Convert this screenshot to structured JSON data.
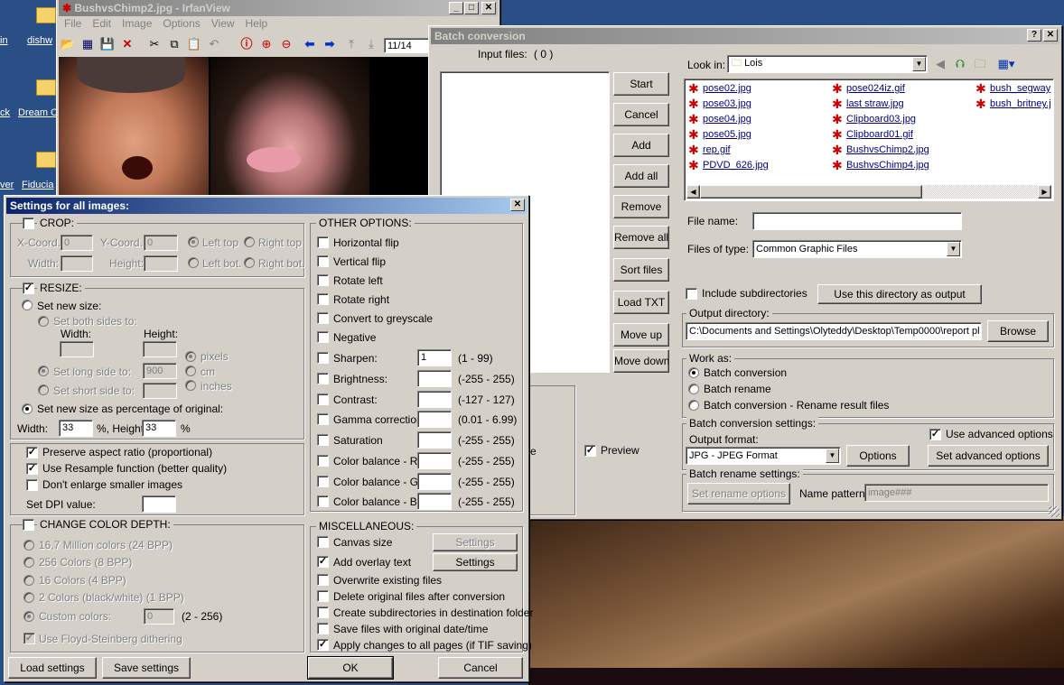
{
  "desktop": {
    "labels": [
      "in",
      "dishw",
      "ck",
      "Dream C",
      "ver",
      "Fiducia"
    ]
  },
  "irfan": {
    "title": "BushvsChimp2.jpg - IrfanView",
    "menu": [
      "File",
      "Edit",
      "Image",
      "Options",
      "View",
      "Help"
    ],
    "page_counter": "11/14"
  },
  "batch": {
    "title": "Batch conversion",
    "input_files_label": "Input files:",
    "input_files_count": "( 0 )",
    "buttons": {
      "start": "Start",
      "cancel": "Cancel",
      "add": "Add",
      "add_all": "Add all",
      "remove": "Remove",
      "remove_all": "Remove all",
      "sort_files": "Sort files",
      "load_txt": "Load TXT",
      "move_up": "Move up",
      "move_down": "Move down"
    },
    "look_in_label": "Look in:",
    "look_in_value": "Lois",
    "files": [
      "pose02.jpg",
      "pose03.jpg",
      "pose04.jpg",
      "pose05.jpg",
      "rep.gif",
      "PDVD_626.jpg",
      "pose024iz.gif",
      "last straw.jpg",
      "Clipboard03.jpg",
      "Clipboard01.gif",
      "BushvsChimp2.jpg",
      "BushvsChimp4.jpg",
      "bush_segway",
      "bush_britney.jp"
    ],
    "file_name_label": "File name:",
    "file_name_value": "",
    "files_of_type_label": "Files of type:",
    "files_of_type_value": "Common Graphic Files",
    "include_subdirs": "Include subdirectories",
    "use_dir_output": "Use this directory as output",
    "output_dir_label": "Output directory:",
    "output_dir_value": "C:\\Documents and Settings\\Olyteddy\\Desktop\\Temp0000\\report pl",
    "browse": "Browse",
    "work_as_label": "Work as:",
    "work_as": [
      "Batch conversion",
      "Batch rename",
      "Batch conversion - Rename result files"
    ],
    "conv_settings_label": "Batch conversion settings:",
    "output_format_label": "Output format:",
    "output_format_value": "JPG - JPEG Format",
    "options": "Options",
    "use_advanced": "Use advanced options",
    "set_advanced": "Set advanced options",
    "rename_settings_label": "Batch rename settings:",
    "set_rename": "Set rename options",
    "name_pattern_label": "Name pattern:",
    "name_pattern_value": "image###",
    "preview": "Preview",
    "partial_e": "e"
  },
  "settings": {
    "title": "Settings for all images:",
    "crop": {
      "label": "CROP:",
      "xcoord": "X-Coord.:",
      "ycoord": "Y-Coord.:",
      "width": "Width:",
      "height": "Height:",
      "xval": "0",
      "yval": "0",
      "left_top": "Left top",
      "right_top": "Right top",
      "left_bot": "Left bot.",
      "right_bot": "Right bot."
    },
    "resize": {
      "label": "RESIZE:",
      "set_new_size": "Set new size:",
      "set_both": "Set both sides to:",
      "width": "Width:",
      "height": "Height:",
      "pixels": "pixels",
      "cm": "cm",
      "inches": "inches",
      "set_long": "Set long side to:",
      "long_val": "900",
      "set_short": "Set short side to:",
      "set_pct": "Set new size as percentage of original:",
      "pct_width_label": "Width:",
      "pct_width": "33",
      "pct_height_label": "%, Height:",
      "pct_height": "33",
      "pct": "%"
    },
    "preserve": "Preserve aspect ratio (proportional)",
    "resample": "Use Resample function (better quality)",
    "dont_enlarge": "Don't enlarge smaller images",
    "dpi": "Set DPI value:",
    "color_depth": {
      "label": "CHANGE COLOR DEPTH:",
      "options": [
        "16,7 Million colors (24 BPP)",
        "256 Colors (8 BPP)",
        "16 Colors (4 BPP)",
        "2 Colors (black/white) (1 BPP)",
        "Custom colors:"
      ],
      "custom_val": "0",
      "custom_range": "(2 - 256)",
      "dither": "Use Floyd-Steinberg dithering"
    },
    "other": {
      "label": "OTHER OPTIONS:",
      "hflip": "Horizontal flip",
      "vflip": "Vertical flip",
      "rot_left": "Rotate left",
      "rot_right": "Rotate right",
      "grey": "Convert to greyscale",
      "negative": "Negative",
      "adjust": [
        {
          "label": "Sharpen:",
          "value": "1",
          "range": "(1  -  99)"
        },
        {
          "label": "Brightness:",
          "value": "",
          "range": "(-255  -  255)"
        },
        {
          "label": "Contrast:",
          "value": "",
          "range": "(-127  -  127)"
        },
        {
          "label": "Gamma correction:",
          "value": "",
          "range": "(0.01  -  6.99)"
        },
        {
          "label": "Saturation",
          "value": "",
          "range": "(-255  -  255)"
        },
        {
          "label": "Color balance - R:",
          "value": "",
          "range": "(-255  -  255)"
        },
        {
          "label": "Color balance - G:",
          "value": "",
          "range": "(-255  -  255)"
        },
        {
          "label": "Color balance - B:",
          "value": "",
          "range": "(-255  -  255)"
        }
      ]
    },
    "misc": {
      "label": "MISCELLANEOUS:",
      "canvas": "Canvas size",
      "overlay": "Add overlay text",
      "settings": "Settings",
      "overwrite": "Overwrite existing files",
      "delete": "Delete original files after conversion",
      "subdirs": "Create subdirectories in destination folder",
      "orig_date": "Save files with original date/time",
      "apply_tif": "Apply changes to all pages (if TIF saving)"
    },
    "load": "Load settings",
    "save": "Save settings",
    "ok": "OK",
    "cancel": "Cancel"
  }
}
